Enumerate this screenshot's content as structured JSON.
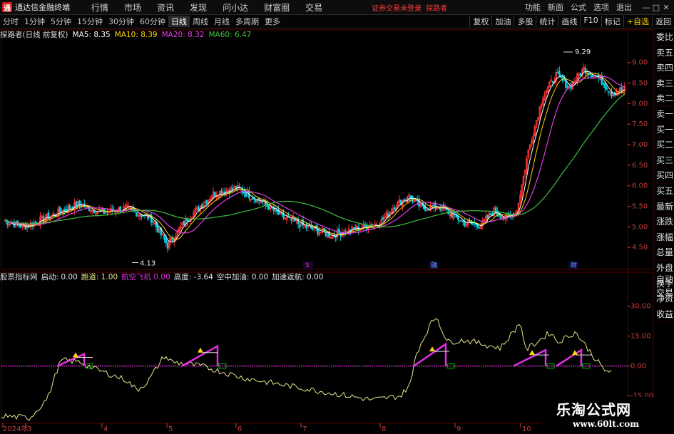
{
  "window": {
    "logo_glyph": "通",
    "title": "通达信金融终端",
    "menu": [
      "行情",
      "市场",
      "资讯",
      "发现",
      "问小达",
      "财富圈",
      "交易"
    ],
    "promo_left": "证券交易未登录",
    "promo_right": "探路者",
    "right_menu": [
      "功能",
      "新面",
      "公式",
      "选项",
      "退出"
    ],
    "controls": [
      "—",
      "□",
      "✕"
    ]
  },
  "toolbar": {
    "periods": [
      "分时",
      "1分钟",
      "5分钟",
      "15分钟",
      "30分钟",
      "60分钟",
      "日线",
      "周线",
      "月线",
      "多周期"
    ],
    "active_period": "日线",
    "more": "更多",
    "tools": [
      "复权",
      "加油",
      "多股",
      "统计",
      "画线",
      "F10",
      "标记",
      "+自选",
      "返回"
    ]
  },
  "main_legend": {
    "name": "探路者(日线 前复权)",
    "ma5_label": "MA5:",
    "ma5_value": "8.35",
    "ma5_color": "#ffffff",
    "ma10_label": "MA10:",
    "ma10_value": "8.39",
    "ma10_color": "#ffd200",
    "ma20_label": "MA20:",
    "ma20_value": "8.32",
    "ma20_color": "#e040e0",
    "ma60_label": "MA60:",
    "ma60_value": "6.47",
    "ma60_color": "#40c040"
  },
  "sub_legend": {
    "name": "股票指标网",
    "qidong_label": "启动:",
    "qidong_value": "0.00",
    "paodao_label": "跑道:",
    "paodao_value": "1.00",
    "feiji_label": "航空飞机",
    "feiji_value": "0.00",
    "gaodu_label": "高度:",
    "gaodu_value": "-3.64",
    "jiayou_label": "空中加油:",
    "jiayou_value": "0.00",
    "fanhang_label": "加速返航:",
    "fanhang_value": "0.00"
  },
  "side_panel": [
    "委比",
    "卖五",
    "卖四",
    "卖三",
    "卖二",
    "卖一",
    "买一",
    "买二",
    "买三",
    "买四",
    "买五",
    "最新",
    "涨跌",
    "涨幅",
    "总量",
    "外盘",
    "换手",
    "净资",
    "收益"
  ],
  "side_panel_lower": [
    "自动",
    "交易"
  ],
  "price_axis": [
    "9.00",
    "8.50",
    "8.00",
    "7.50",
    "7.00",
    "6.50",
    "6.00",
    "5.50",
    "5.00",
    "4.50"
  ],
  "indicator_axis": [
    "30.00",
    "15.00",
    "0.00",
    "-15.00"
  ],
  "date_axis": [
    "2024年",
    "3",
    "4",
    "5",
    "6",
    "7",
    "8",
    "9",
    "10"
  ],
  "annotations": {
    "high_label": "9.29",
    "low_label": "4.13",
    "event_marks": [
      "S",
      "融",
      "财"
    ]
  },
  "colors": {
    "up": "#ff3232",
    "down": "#00d2e6",
    "grid": "#5a0000",
    "axis_text": "#c83c3c",
    "line_yellow": "#e6e68c",
    "line_magenta": "#e030e0",
    "marker_yellow": "#ffd700",
    "marker_green": "#00c000"
  },
  "watermark": {
    "title": "乐淘公式网",
    "url": "www.60lt.com"
  }
}
